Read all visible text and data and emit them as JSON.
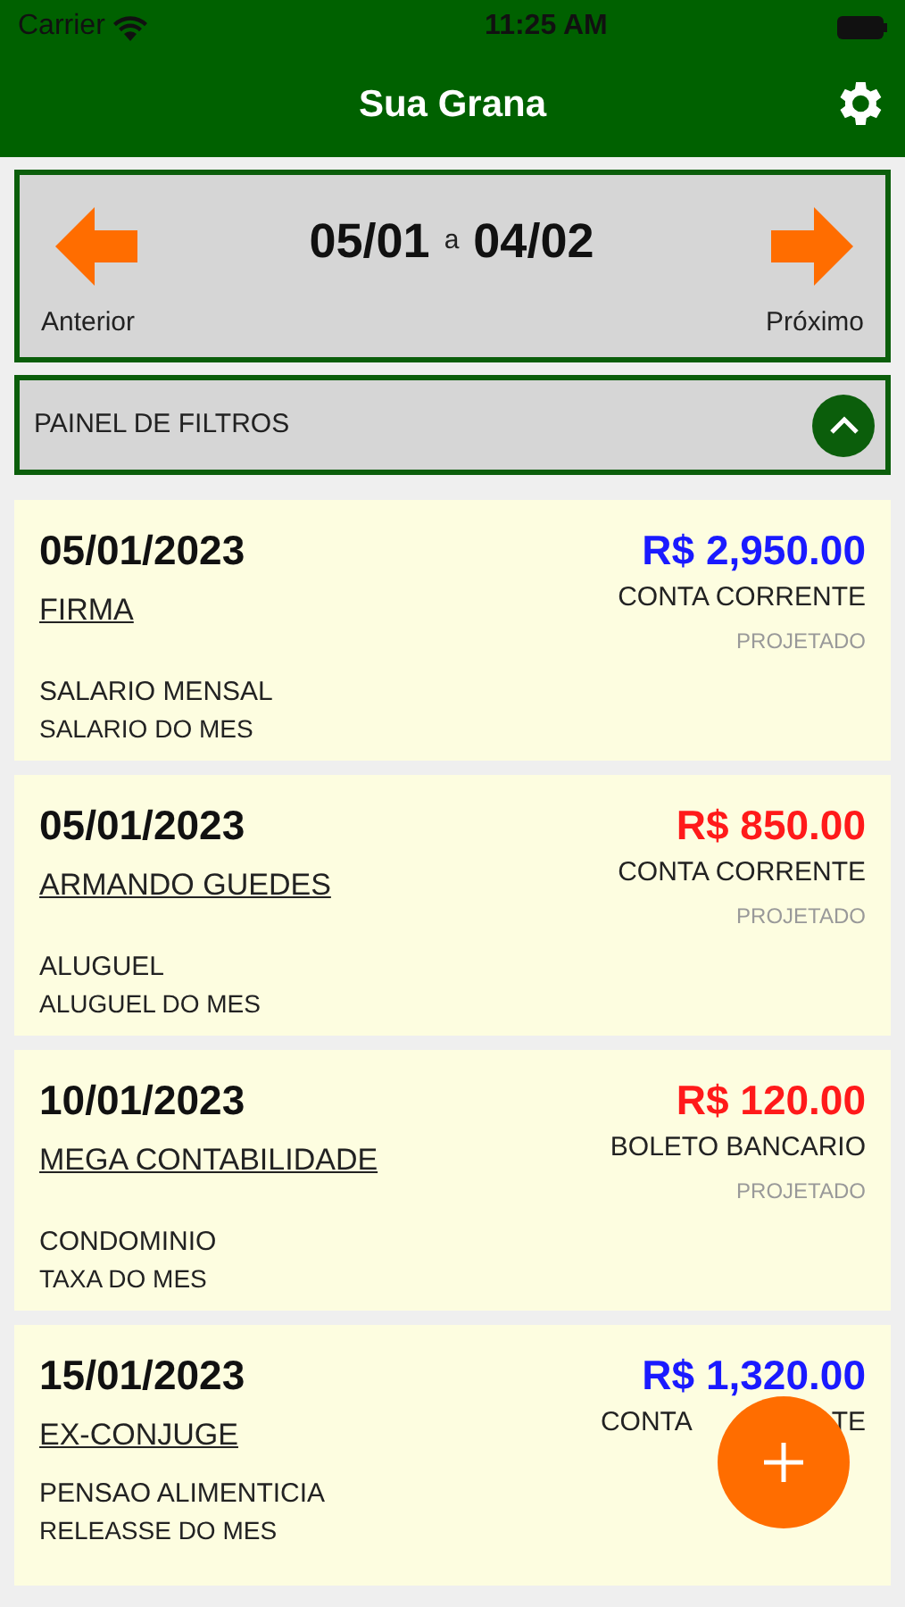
{
  "status_bar": {
    "carrier": "Carrier",
    "time": "11:25 AM"
  },
  "header": {
    "title": "Sua Grana"
  },
  "period": {
    "start": "05/01",
    "separator": "a",
    "end": "04/02",
    "previous_label": "Anterior",
    "next_label": "Próximo"
  },
  "filters": {
    "label": "PAINEL DE FILTROS",
    "expanded": true
  },
  "entries": [
    {
      "date": "05/01/2023",
      "amount": "R$ 2,950.00",
      "kind": "income",
      "account": "CONTA CORRENTE",
      "payee": "FIRMA",
      "status": "PROJETADO",
      "category": "SALARIO MENSAL",
      "description": "SALARIO DO MES"
    },
    {
      "date": "05/01/2023",
      "amount": "R$ 850.00",
      "kind": "expense",
      "account": "CONTA CORRENTE",
      "payee": "ARMANDO GUEDES",
      "status": "PROJETADO",
      "category": "ALUGUEL",
      "description": "ALUGUEL DO MES"
    },
    {
      "date": "10/01/2023",
      "amount": "R$ 120.00",
      "kind": "expense",
      "account": "BOLETO BANCARIO",
      "payee": "MEGA CONTABILIDADE",
      "status": "PROJETADO",
      "category": "CONDOMINIO",
      "description": "TAXA DO MES"
    },
    {
      "date": "15/01/2023",
      "amount": "R$ 1,320.00",
      "kind": "income",
      "account_parts": [
        "CONTA",
        "TE"
      ],
      "payee": "EX-CONJUGE",
      "category": "PENSAO ALIMENTICIA",
      "description": "RELEASSE DO MES"
    }
  ]
}
